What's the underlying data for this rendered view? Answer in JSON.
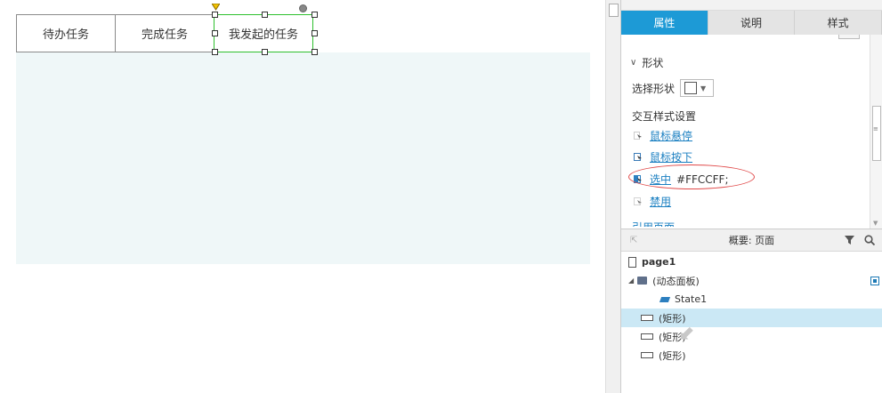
{
  "canvas": {
    "tabs": [
      {
        "label": "待办任务"
      },
      {
        "label": "完成任务"
      },
      {
        "label": "我发起的任务"
      }
    ],
    "panel_color": "#eff7f8",
    "selection_color": "#2ec02e"
  },
  "inspector": {
    "tabs": [
      {
        "label": "属性",
        "active": true
      },
      {
        "label": "说明",
        "active": false
      },
      {
        "label": "样式",
        "active": false
      }
    ],
    "accent": "#1d9ad6",
    "shape_section": {
      "title": "形状",
      "select_label": "选择形状"
    },
    "interaction": {
      "title": "交互样式设置",
      "items": [
        {
          "label": "鼠标悬停",
          "icon": "hover-style-icon"
        },
        {
          "label": "鼠标按下",
          "icon": "mousedown-style-icon"
        },
        {
          "label": "选中",
          "icon": "selected-style-icon",
          "value": "#FFCCFF;"
        },
        {
          "label": "禁用",
          "icon": "disabled-style-icon"
        }
      ]
    },
    "cut_off_label": "引用页面"
  },
  "outline": {
    "title": "概要: 页面",
    "items": [
      {
        "label": "page1",
        "type": "page"
      },
      {
        "label": "(动态面板)",
        "type": "dynamic-panel"
      },
      {
        "label": "State1",
        "type": "state"
      },
      {
        "label": "(矩形)",
        "type": "rect",
        "selected": true
      },
      {
        "label": "(矩形)",
        "type": "rect"
      },
      {
        "label": "(矩形)",
        "type": "rect"
      }
    ]
  }
}
